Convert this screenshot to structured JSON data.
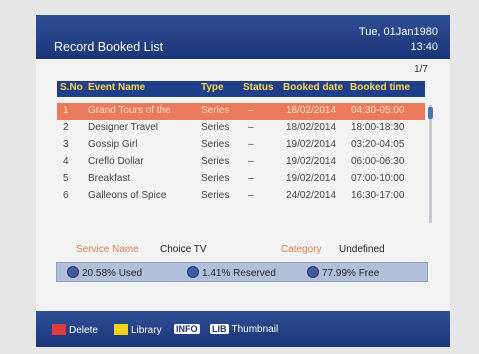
{
  "header": {
    "title": "Record Booked List",
    "date": "Tue, 01Jan1980",
    "time": "13:40"
  },
  "page_indicator": "1/7",
  "columns": [
    "S.No",
    "Event Name",
    "Type",
    "Status",
    "Booked date",
    "Booked time"
  ],
  "rows": [
    {
      "no": "1",
      "name": "Grand Tours of the",
      "type": "Series",
      "status": "–",
      "date": "18/02/2014",
      "time": "04:30-05:00"
    },
    {
      "no": "2",
      "name": "Designer Travel",
      "type": "Series",
      "status": "–",
      "date": "18/02/2014",
      "time": "18:00-18:30"
    },
    {
      "no": "3",
      "name": "Gossip Girl",
      "type": "Series",
      "status": "–",
      "date": "19/02/2014",
      "time": "03:20-04:05"
    },
    {
      "no": "4",
      "name": "Creflo Dollar",
      "type": "Series",
      "status": "–",
      "date": "19/02/2014",
      "time": "06:00-06:30"
    },
    {
      "no": "5",
      "name": "Breakfast",
      "type": "Series",
      "status": "–",
      "date": "19/02/2014",
      "time": "07:00-10:00"
    },
    {
      "no": "6",
      "name": "Galleons of Spice",
      "type": "Series",
      "status": "–",
      "date": "24/02/2014",
      "time": "16:30-17:00"
    }
  ],
  "details": {
    "service_label": "Service Name",
    "service_value": "Choice TV",
    "category_label": "Category",
    "category_value": "Undefined"
  },
  "storage": {
    "used": "20.58% Used",
    "reserved": "1.41% Reserved",
    "free": "77.99% Free"
  },
  "footer": {
    "delete": "Delete",
    "library": "Library",
    "info_key": "INFO",
    "lib_key": "LIB",
    "thumbnail": "Thumbnail"
  },
  "colors": {
    "header": "#1f3f8a",
    "selection": "#ea7a5b",
    "column_header_text": "#ffd64a",
    "red_key": "#e03c3c",
    "yellow_key": "#f2d21a",
    "label_orange": "#d8824a"
  }
}
